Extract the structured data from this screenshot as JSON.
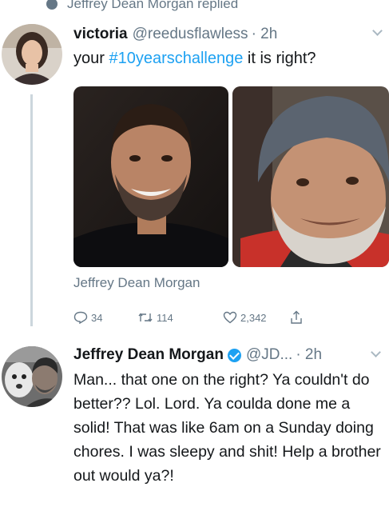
{
  "reply_context": {
    "text": "Jeffrey Dean Morgan replied",
    "icon": "reply-bubble-icon"
  },
  "tweet1": {
    "author_name": "victoria",
    "author_handle": "@reedusflawless",
    "time": "· 2h",
    "text_prefix": "your ",
    "hashtag": "#10yearschallenge",
    "text_suffix": " it is right?",
    "photo_caption": "Jeffrey Dean Morgan",
    "counts": {
      "replies": "34",
      "retweets": "114",
      "likes": "2,342"
    }
  },
  "tweet2": {
    "author_name": "Jeffrey Dean Morgan",
    "author_handle": "@JD...",
    "time": "· 2h",
    "text": "Man... that one on the right? Ya couldn't do better?? Lol. Lord. Ya coulda done me a solid! That was like 6am on a Sunday doing chores. I was sleepy and shit! Help a brother out would ya?!"
  },
  "colors": {
    "accent": "#1da1f2",
    "muted": "#657786",
    "text": "#14171a",
    "thread_line": "#ccd6dd"
  }
}
